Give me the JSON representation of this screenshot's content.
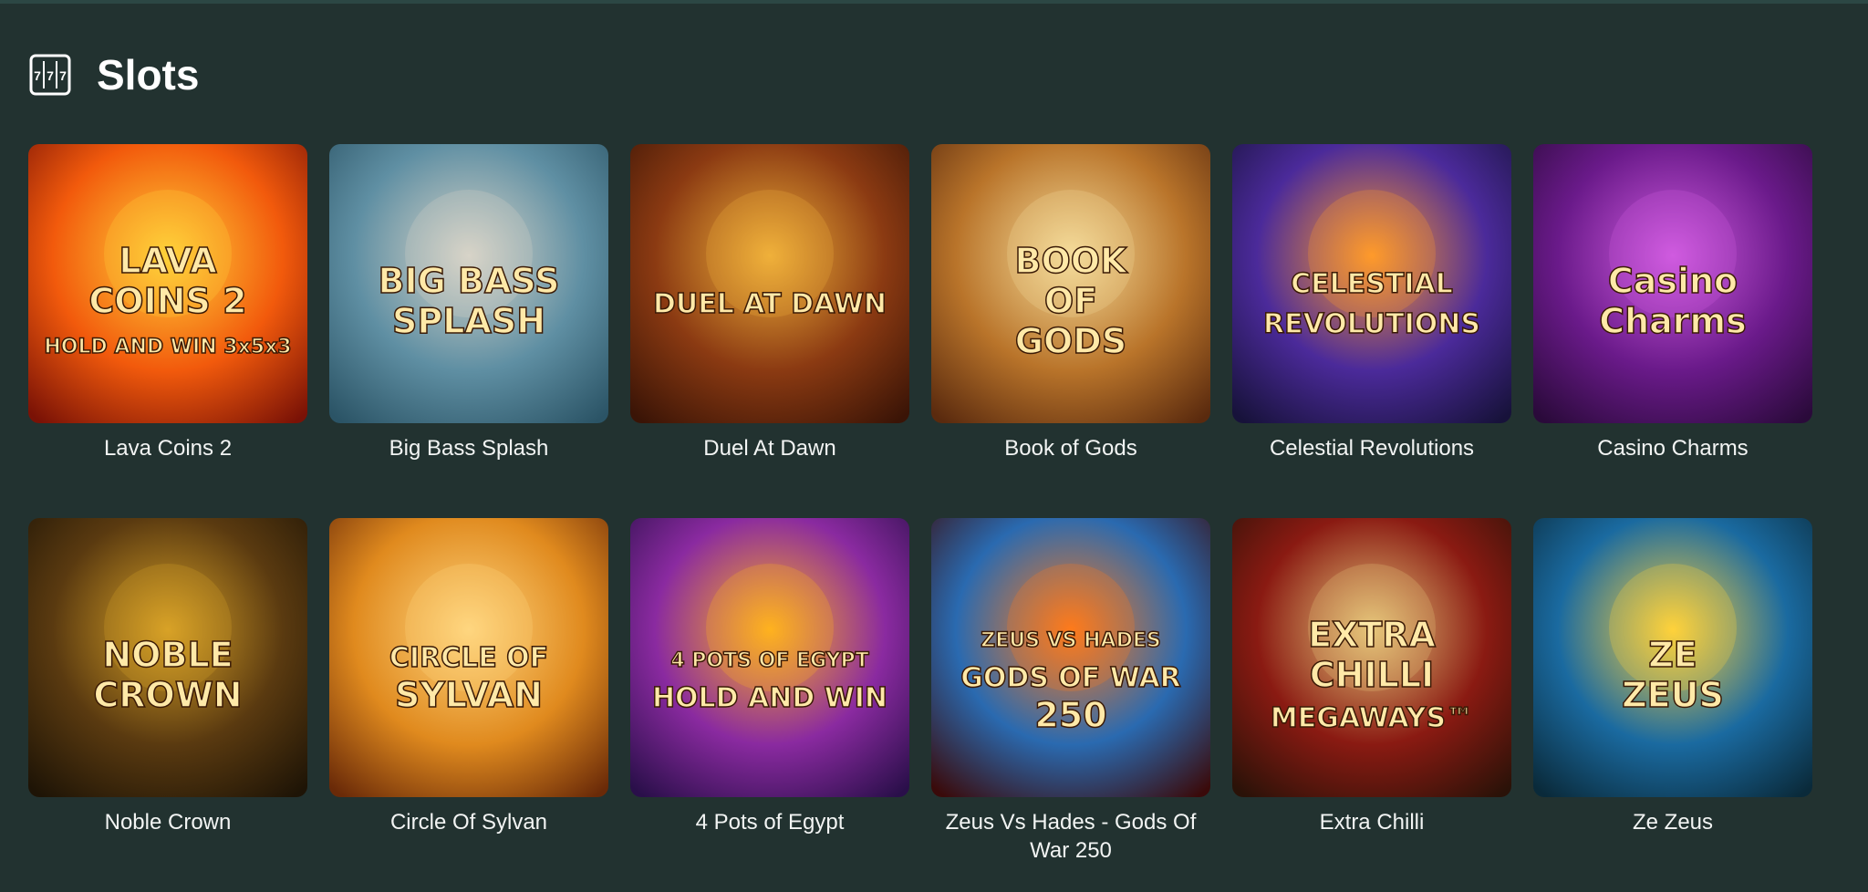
{
  "section": {
    "title": "Slots",
    "icon": "slot-machine-icon"
  },
  "games": [
    {
      "name": "Lava Coins 2",
      "art_lines": [
        "LAVA",
        "COINS 2",
        "HOLD AND WIN 3x5x3"
      ],
      "colors": [
        "#ffd23a",
        "#f25a0c",
        "#7a1206"
      ]
    },
    {
      "name": "Big Bass Splash",
      "art_lines": [
        "BIG BASS",
        "SPLASH"
      ],
      "colors": [
        "#d8d4c8",
        "#5f8fa3",
        "#2b5466"
      ]
    },
    {
      "name": "Duel At Dawn",
      "art_lines": [
        "DUEL AT DAWN"
      ],
      "colors": [
        "#f0b13a",
        "#8b3a12",
        "#3a1406"
      ]
    },
    {
      "name": "Book of Gods",
      "art_lines": [
        "BOOK",
        "OF",
        "GODS"
      ],
      "colors": [
        "#f5dc9a",
        "#b9742a",
        "#5a2a0e"
      ]
    },
    {
      "name": "Celestial Revolutions",
      "art_lines": [
        "CELESTIAL",
        "REVOLUTIONS"
      ],
      "colors": [
        "#ff9a2a",
        "#4b2a9a",
        "#17123a"
      ]
    },
    {
      "name": "Casino Charms",
      "art_lines": [
        "Casino",
        "Charms"
      ],
      "colors": [
        "#d05be0",
        "#6a1a8a",
        "#2a0a3a"
      ]
    },
    {
      "name": "Noble Crown",
      "art_lines": [
        "NOBLE",
        "CROWN"
      ],
      "colors": [
        "#d9a227",
        "#5a3a10",
        "#1e1406"
      ]
    },
    {
      "name": "Circle Of Sylvan",
      "art_lines": [
        "CIRCLE OF",
        "SYLVAN"
      ],
      "colors": [
        "#ffd680",
        "#e08a1e",
        "#6a2a08"
      ]
    },
    {
      "name": "4 Pots of Egypt",
      "art_lines": [
        "4 POTS OF EGYPT",
        "HOLD AND WIN"
      ],
      "colors": [
        "#ffb21e",
        "#8a2aa0",
        "#2a0f4a"
      ]
    },
    {
      "name": "Zeus Vs Hades - Gods Of War 250",
      "art_lines": [
        "ZEUS VS HADES",
        "GODS OF WAR",
        "250"
      ],
      "colors": [
        "#ff7a1a",
        "#2a6ab0",
        "#3a0a0a"
      ]
    },
    {
      "name": "Extra Chilli",
      "art_lines": [
        "EXTRA",
        "CHILLI",
        "MEGAWAYS™"
      ],
      "colors": [
        "#e6c67a",
        "#8a1a12",
        "#2a1208"
      ]
    },
    {
      "name": "Ze Zeus",
      "art_lines": [
        "ZE",
        "ZEUS"
      ],
      "colors": [
        "#ffd23a",
        "#1a6aa0",
        "#0a2a3a"
      ]
    }
  ]
}
